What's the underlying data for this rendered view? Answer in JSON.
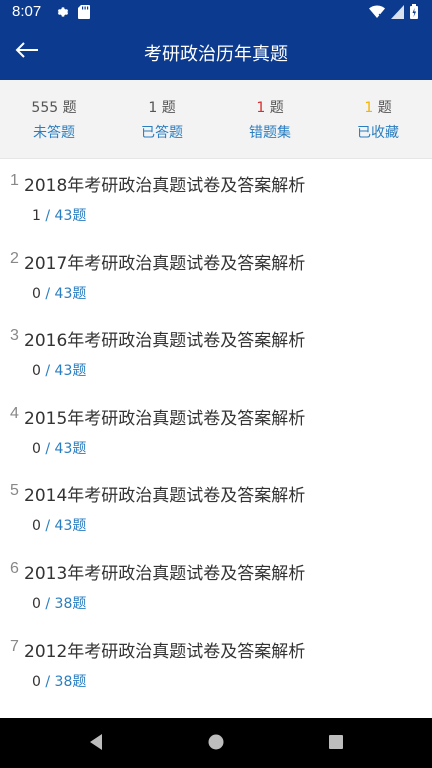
{
  "status_bar": {
    "time": "8:07"
  },
  "toolbar": {
    "title": "考研政治历年真题"
  },
  "stats": [
    {
      "count": "555",
      "unit": "题",
      "label": "未答题",
      "count_color": "#555555"
    },
    {
      "count": "1",
      "unit": "题",
      "label": "已答题",
      "count_color": "#555555"
    },
    {
      "count": "1",
      "unit": "题",
      "label": "错题集",
      "count_color": "#d32f2f"
    },
    {
      "count": "1",
      "unit": "题",
      "label": "已收藏",
      "count_color": "#f4b400"
    }
  ],
  "items": [
    {
      "index": "1",
      "title": "2018年考研政治真题试卷及答案解析",
      "done": "1",
      "total": "/ 43题"
    },
    {
      "index": "2",
      "title": "2017年考研政治真题试卷及答案解析",
      "done": "0",
      "total": "/ 43题"
    },
    {
      "index": "3",
      "title": "2016年考研政治真题试卷及答案解析",
      "done": "0",
      "total": "/ 43题"
    },
    {
      "index": "4",
      "title": "2015年考研政治真题试卷及答案解析",
      "done": "0",
      "total": "/ 43题"
    },
    {
      "index": "5",
      "title": "2014年考研政治真题试卷及答案解析",
      "done": "0",
      "total": "/ 43题"
    },
    {
      "index": "6",
      "title": "2013年考研政治真题试卷及答案解析",
      "done": "0",
      "total": "/ 38题"
    },
    {
      "index": "7",
      "title": "2012年考研政治真题试卷及答案解析",
      "done": "0",
      "total": "/ 38题"
    }
  ],
  "colors": {
    "primary": "#0b3a8f",
    "link": "#2a7ec0",
    "wrong": "#d32f2f",
    "favorite": "#f4b400"
  },
  "icons": [
    "settings-icon",
    "sd-card-icon",
    "wifi-icon",
    "signal-icon",
    "battery-icon",
    "back-arrow-icon",
    "nav-back-icon",
    "nav-home-icon",
    "nav-recents-icon"
  ]
}
